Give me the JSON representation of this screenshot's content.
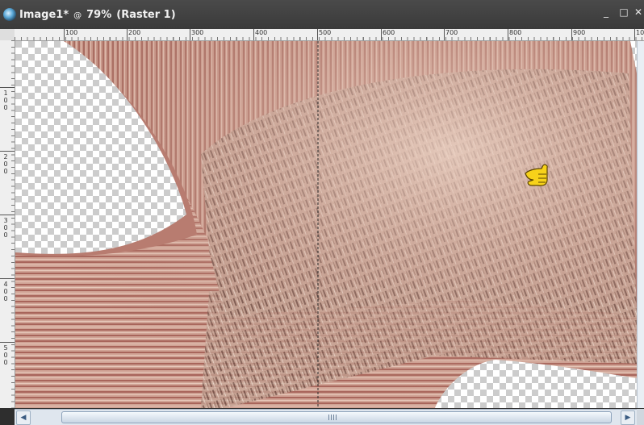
{
  "window": {
    "title_name": "Image1*",
    "title_at_icon": "@",
    "title_zoom": "79%",
    "title_layer": "(Raster 1)",
    "minimize_glyph": "_",
    "maximize_glyph": "□",
    "close_glyph": "✕"
  },
  "ruler_top": {
    "labels": [
      "100",
      "200",
      "300",
      "400",
      "500",
      "600",
      "700",
      "800",
      "900",
      "10"
    ]
  },
  "ruler_left": {
    "labels": [
      [
        "1",
        "0",
        "0"
      ],
      [
        "2",
        "0",
        "0"
      ],
      [
        "3",
        "0",
        "0"
      ],
      [
        "4",
        "0",
        "0"
      ],
      [
        "5",
        "0",
        "0"
      ]
    ]
  },
  "canvas": {
    "description_icon": "pointing-hand-cursor-icon",
    "guide": "vertical-dashed-guide"
  },
  "scrollbar": {
    "left_arrow": "◀",
    "right_arrow": "▶"
  },
  "colors": {
    "titlebar": "#3a3a3a",
    "ruler": "#efefef",
    "scroll_track": "#dfe6ee",
    "pink_brown": "#c08a7c",
    "dark_brown": "#8a5048"
  }
}
